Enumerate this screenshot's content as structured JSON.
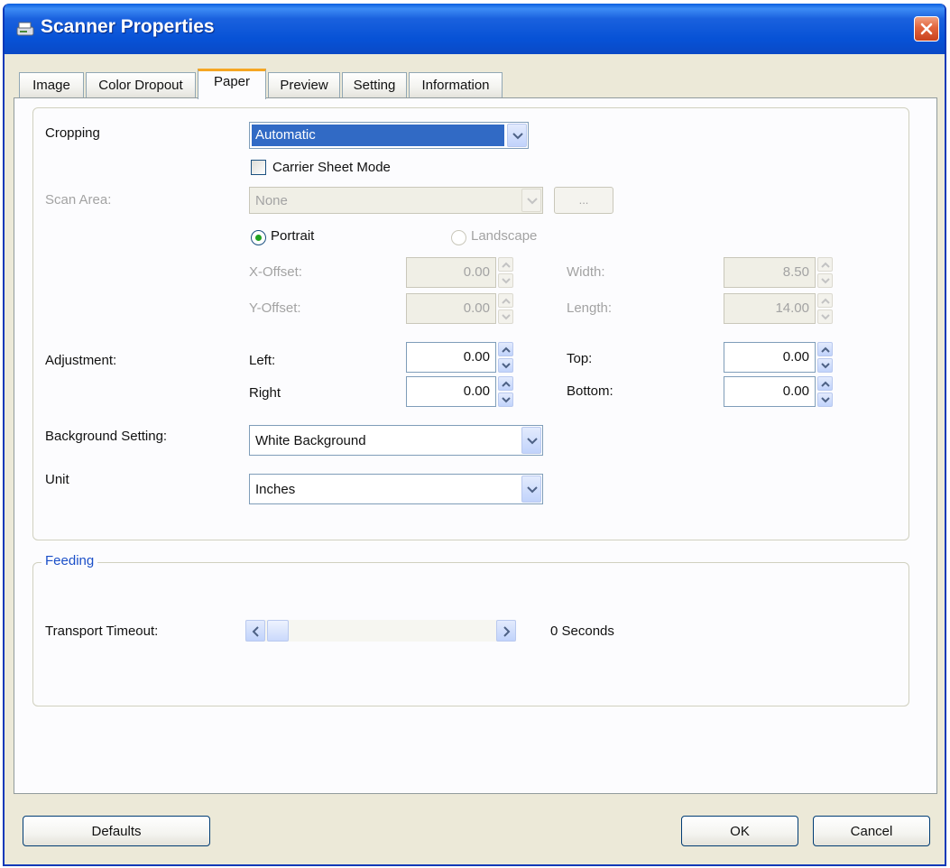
{
  "window": {
    "title": "Scanner Properties"
  },
  "tabs": [
    "Image",
    "Color Dropout",
    "Paper",
    "Preview",
    "Setting",
    "Information"
  ],
  "active_tab": "Paper",
  "cropping": {
    "label": "Cropping",
    "value": "Automatic",
    "carrier_sheet_label": "Carrier Sheet Mode",
    "carrier_sheet_checked": false
  },
  "scan_area": {
    "label": "Scan Area:",
    "value": "None",
    "browse_label": "...",
    "portrait_label": "Portrait",
    "landscape_label": "Landscape",
    "orientation": "Portrait"
  },
  "offsets": {
    "x_label": "X-Offset:",
    "x_value": "0.00",
    "y_label": "Y-Offset:",
    "y_value": "0.00",
    "width_label": "Width:",
    "width_value": "8.50",
    "length_label": "Length:",
    "length_value": "14.00"
  },
  "adjustment": {
    "label": "Adjustment:",
    "left_label": "Left:",
    "left_value": "0.00",
    "right_label": "Right",
    "right_value": "0.00",
    "top_label": "Top:",
    "top_value": "0.00",
    "bottom_label": "Bottom:",
    "bottom_value": "0.00"
  },
  "background": {
    "label": "Background Setting:",
    "value": "White Background"
  },
  "unit": {
    "label": "Unit",
    "value": "Inches"
  },
  "feeding": {
    "legend": "Feeding",
    "timeout_label": "Transport Timeout:",
    "timeout_text": "0 Seconds",
    "timeout_fraction": 0.0
  },
  "buttons": {
    "defaults": "Defaults",
    "ok": "OK",
    "cancel": "Cancel"
  },
  "colors": {
    "titlebar": "#0a5fe0",
    "selection": "#316ac5",
    "active_tab_accent": "#f5a623",
    "group_legend": "#1b4fc8"
  }
}
